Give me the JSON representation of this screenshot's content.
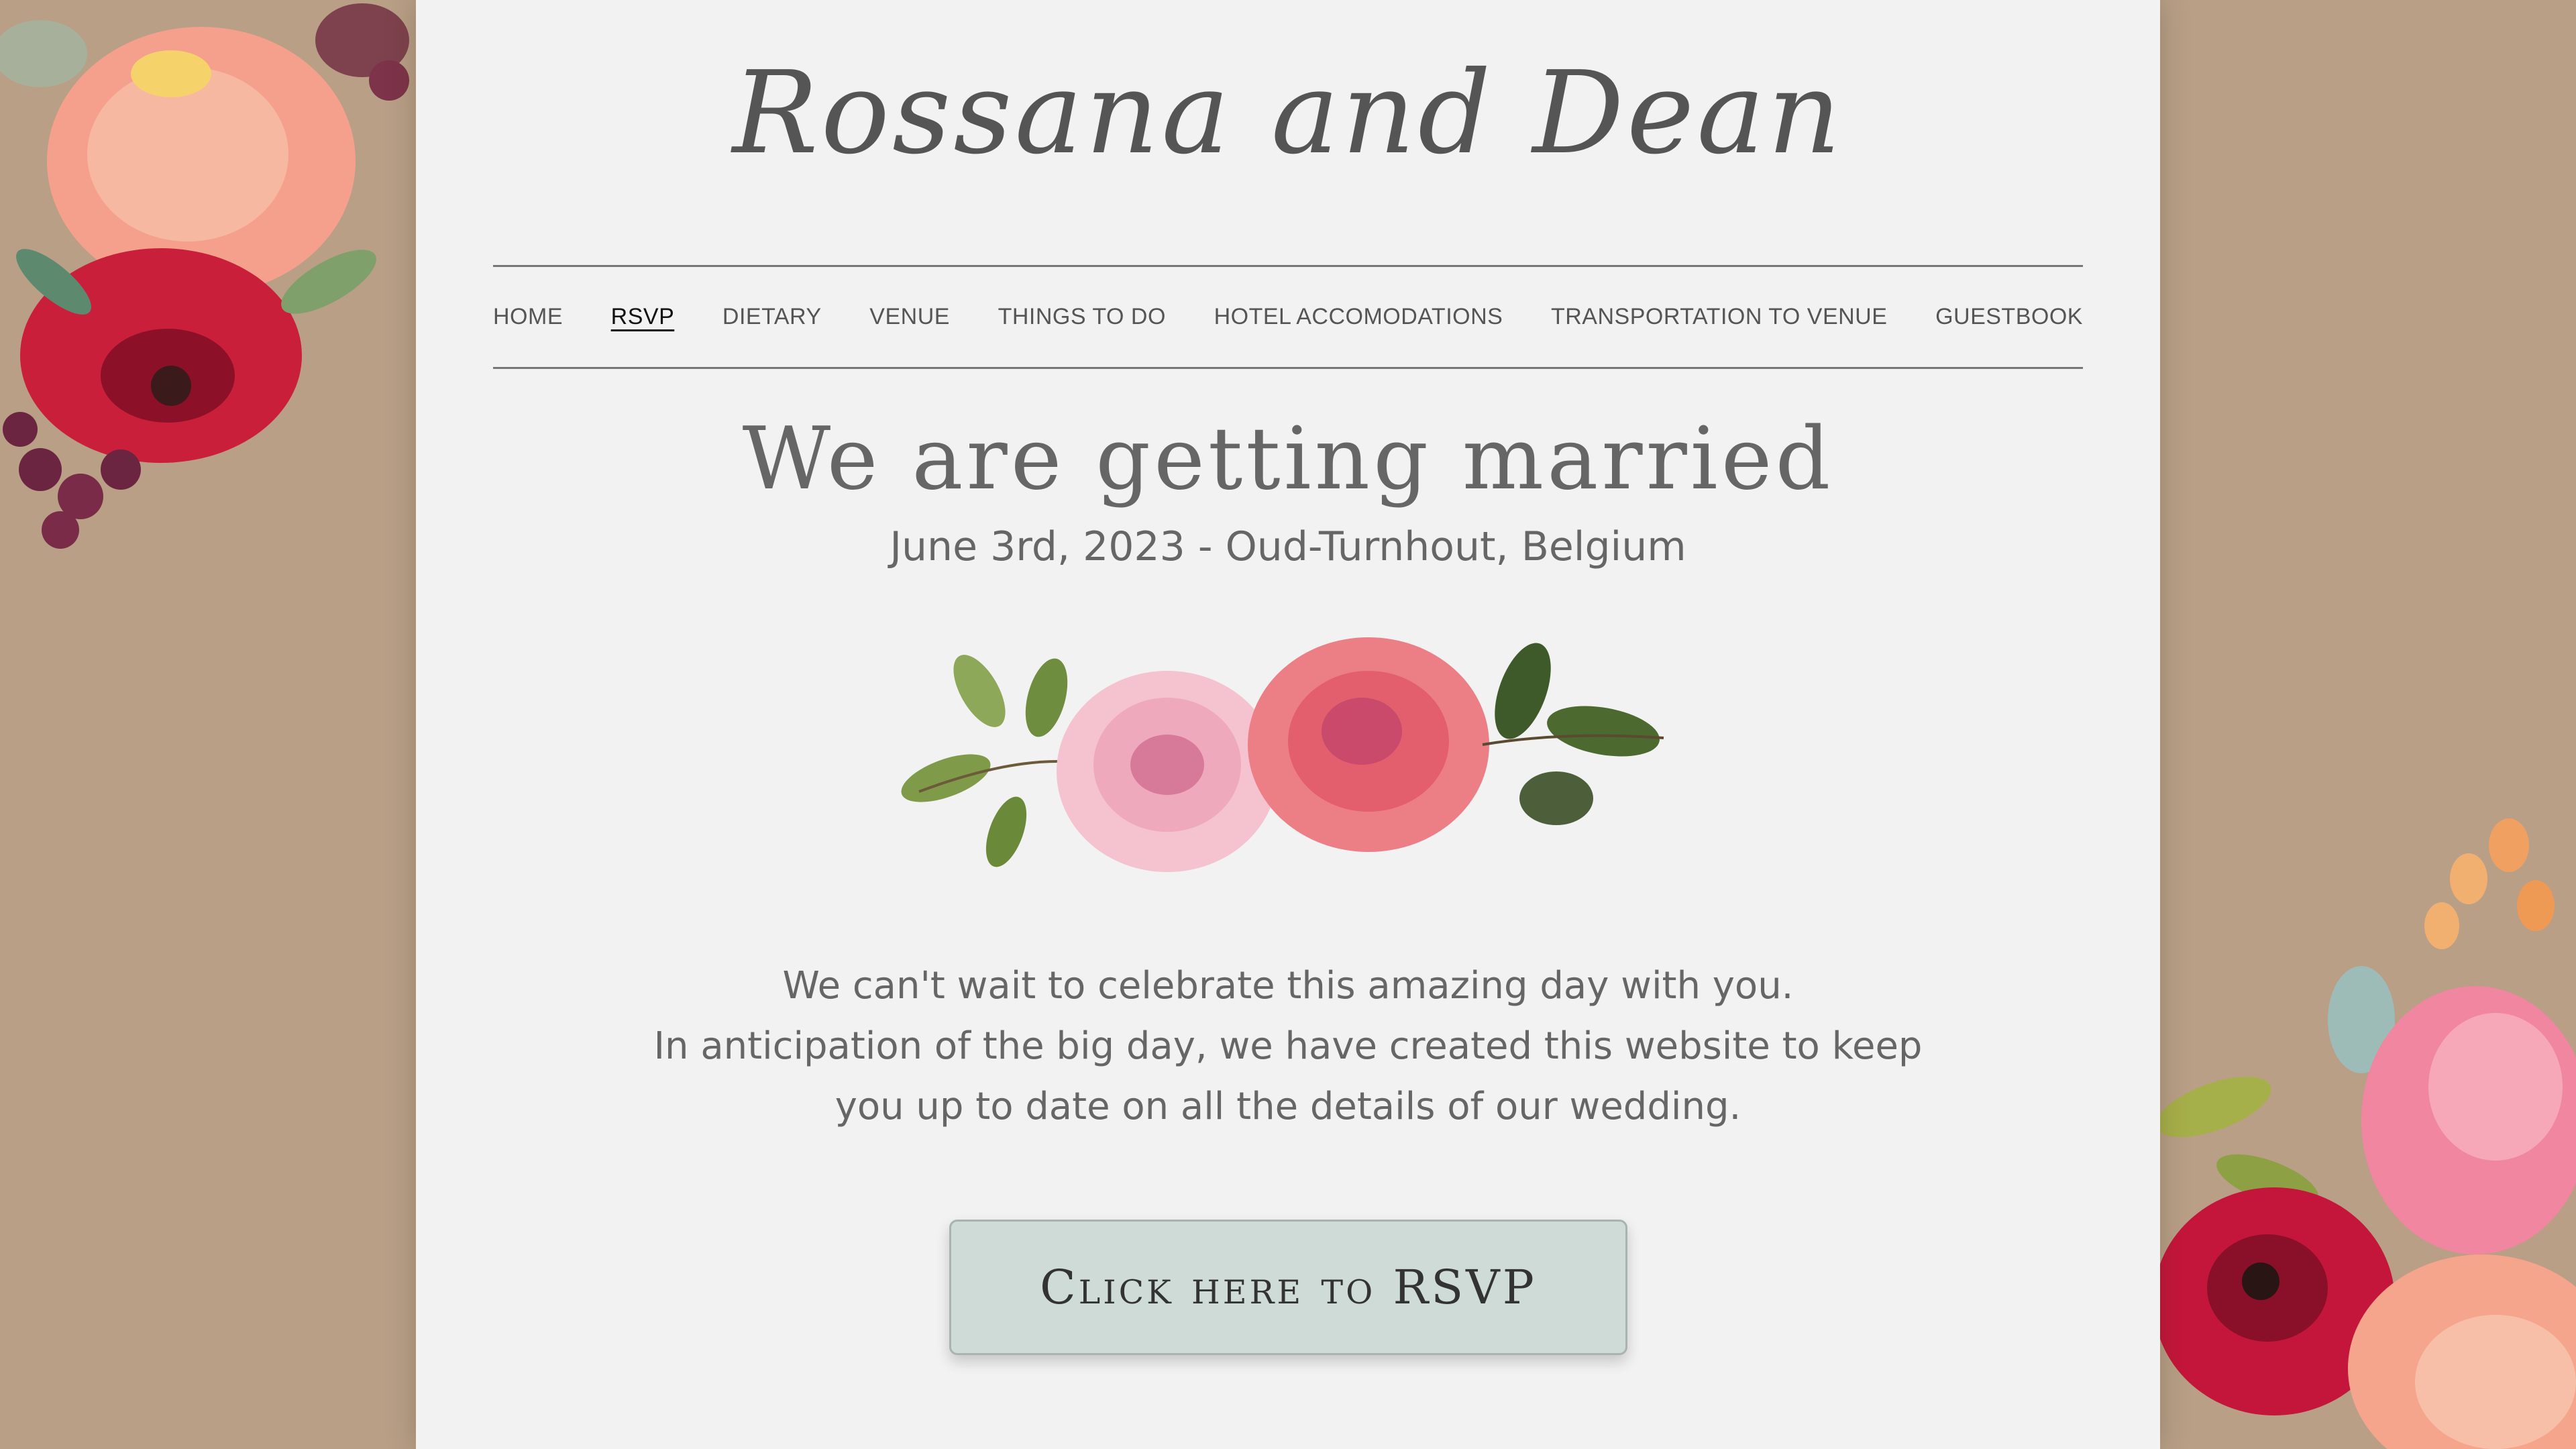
{
  "site": {
    "logo_text": "Rossana and Dean"
  },
  "nav": {
    "items": [
      {
        "label": "HOME",
        "active": false
      },
      {
        "label": "RSVP",
        "active": true
      },
      {
        "label": "DIETARY",
        "active": false
      },
      {
        "label": "VENUE",
        "active": false
      },
      {
        "label": "THINGS TO DO",
        "active": false
      },
      {
        "label": "HOTEL ACCOMODATIONS",
        "active": false
      },
      {
        "label": "TRANSPORTATION TO VENUE",
        "active": false
      },
      {
        "label": "GUESTBOOK",
        "active": false
      }
    ]
  },
  "hero": {
    "title": "We are getting married",
    "subtitle": "June 3rd, 2023 - Oud-Turnhout, Belgium"
  },
  "intro": {
    "lines": [
      "We can't wait to celebrate this amazing day with you.",
      "In anticipation of the big day, we have created this website to keep",
      "you up to date on all the details of our wedding."
    ]
  },
  "cta": {
    "label": "Click here to RSVP"
  },
  "colors": {
    "background": "#b89f86",
    "panel": "#f2f2f2",
    "button": "#cfdbd6",
    "text": "#666666"
  },
  "icons": {
    "corner_top_left": "watercolor-flowers-icon",
    "center_divider": "watercolor-roses-icon",
    "corner_bottom_right": "watercolor-flowers-icon"
  }
}
